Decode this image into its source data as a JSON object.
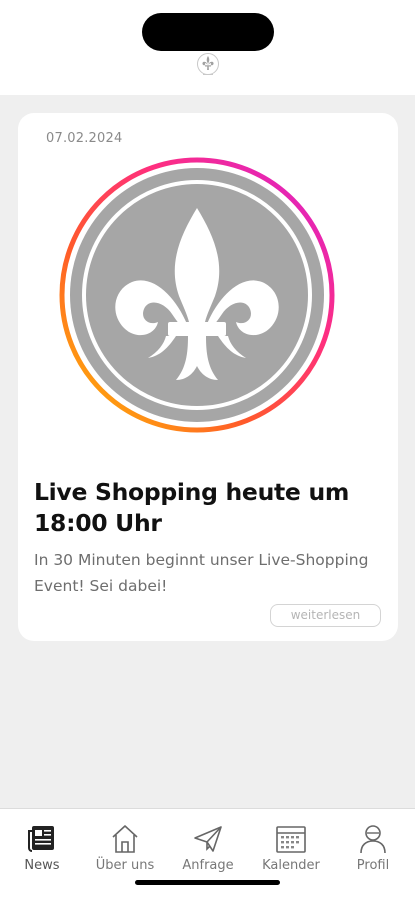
{
  "feed": {
    "post": {
      "date": "07.02.2024",
      "title": "Live Shopping heute um 18:00 Uhr",
      "excerpt": "In 30 Minuten beginnt unser Live-Shopping Event! Sei dabei!",
      "read_more_label": "weiterlesen"
    }
  },
  "tabbar": {
    "items": [
      {
        "label": "News",
        "icon": "newspaper-icon",
        "active": true
      },
      {
        "label": "Über uns",
        "icon": "house-icon",
        "active": false
      },
      {
        "label": "Anfrage",
        "icon": "paper-plane-icon",
        "active": false
      },
      {
        "label": "Kalender",
        "icon": "calendar-icon",
        "active": false
      },
      {
        "label": "Profil",
        "icon": "person-icon",
        "active": false
      }
    ]
  },
  "colors": {
    "ring_start": "#ff2fd0",
    "ring_mid": "#ff4a6a",
    "ring_end": "#ffb800",
    "emblem_gray": "#a6a6a6"
  }
}
